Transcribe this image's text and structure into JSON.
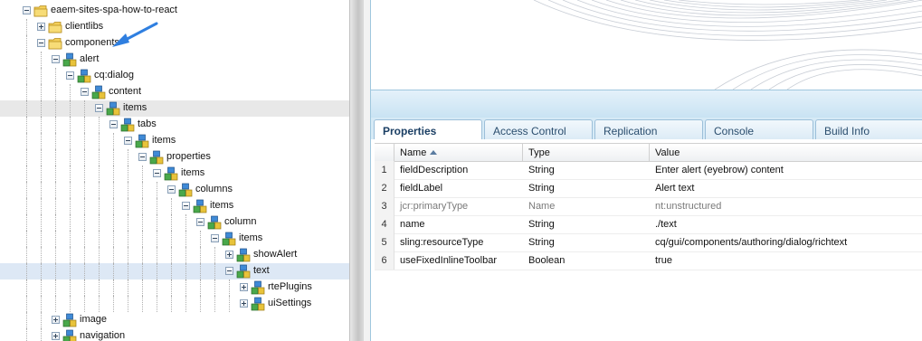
{
  "tree": [
    {
      "label": "eaem-sites-spa-how-to-react",
      "icon": "folder-icon",
      "expander": "minus",
      "depth": 1
    },
    {
      "label": "clientlibs",
      "icon": "folder-icon",
      "expander": "plus",
      "depth": 2
    },
    {
      "label": "components",
      "icon": "folder-icon",
      "expander": "minus",
      "depth": 2
    },
    {
      "label": "alert",
      "icon": "node-icon",
      "expander": "minus",
      "depth": 3
    },
    {
      "label": "cq:dialog",
      "icon": "node-icon",
      "expander": "minus",
      "depth": 4
    },
    {
      "label": "content",
      "icon": "node-icon",
      "expander": "minus",
      "depth": 5
    },
    {
      "label": "items",
      "icon": "node-icon",
      "expander": "minus",
      "depth": 6,
      "state": "sel"
    },
    {
      "label": "tabs",
      "icon": "node-icon",
      "expander": "minus",
      "depth": 7
    },
    {
      "label": "items",
      "icon": "node-icon",
      "expander": "minus",
      "depth": 8
    },
    {
      "label": "properties",
      "icon": "node-icon",
      "expander": "minus",
      "depth": 9
    },
    {
      "label": "items",
      "icon": "node-icon",
      "expander": "minus",
      "depth": 10
    },
    {
      "label": "columns",
      "icon": "node-icon",
      "expander": "minus",
      "depth": 11
    },
    {
      "label": "items",
      "icon": "node-icon",
      "expander": "minus",
      "depth": 12
    },
    {
      "label": "column",
      "icon": "node-icon",
      "expander": "minus",
      "depth": 13
    },
    {
      "label": "items",
      "icon": "node-icon",
      "expander": "minus",
      "depth": 14
    },
    {
      "label": "showAlert",
      "icon": "node-icon",
      "expander": "plus",
      "depth": 15
    },
    {
      "label": "text",
      "icon": "node-icon",
      "expander": "minus",
      "depth": 15,
      "state": "sel2"
    },
    {
      "label": "rtePlugins",
      "icon": "node-icon",
      "expander": "plus",
      "depth": 16
    },
    {
      "label": "uiSettings",
      "icon": "node-icon",
      "expander": "plus",
      "depth": 16
    },
    {
      "label": "image",
      "icon": "node-icon",
      "expander": "plus",
      "depth": 3
    },
    {
      "label": "navigation",
      "icon": "node-icon",
      "expander": "plus",
      "depth": 3
    }
  ],
  "tabs": [
    {
      "label": "Properties",
      "active": true
    },
    {
      "label": "Access Control",
      "active": false
    },
    {
      "label": "Replication",
      "active": false
    },
    {
      "label": "Console",
      "active": false
    },
    {
      "label": "Build Info",
      "active": false
    }
  ],
  "grid": {
    "columns": [
      "Name",
      "Type",
      "Value"
    ],
    "sorted_column": "Name",
    "rows": [
      {
        "num": "1",
        "name": "fieldDescription",
        "type": "String",
        "value": "Enter alert (eyebrow) content",
        "muted": false
      },
      {
        "num": "2",
        "name": "fieldLabel",
        "type": "String",
        "value": "Alert text",
        "muted": false
      },
      {
        "num": "3",
        "name": "jcr:primaryType",
        "type": "Name",
        "value": "nt:unstructured",
        "muted": true
      },
      {
        "num": "4",
        "name": "name",
        "type": "String",
        "value": "./text",
        "muted": false
      },
      {
        "num": "5",
        "name": "sling:resourceType",
        "type": "String",
        "value": "cq/gui/components/authoring/dialog/richtext",
        "muted": false
      },
      {
        "num": "6",
        "name": "useFixedInlineToolbar",
        "type": "Boolean",
        "value": "true",
        "muted": false
      }
    ]
  },
  "colors": {
    "accent": "#1b6bd6",
    "tab_bg": "#d6eaf6",
    "border": "#9fc7de"
  }
}
